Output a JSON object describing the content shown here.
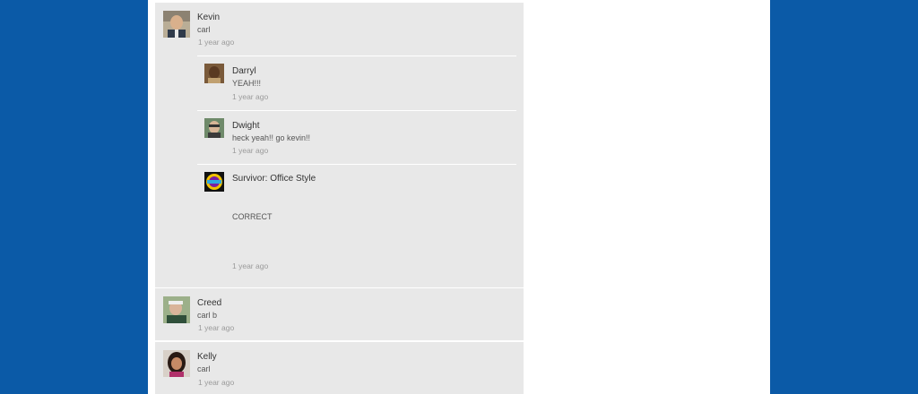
{
  "comments": [
    {
      "name": "Kevin",
      "text": "carl",
      "time": "1 year ago",
      "avatar_icon": "kevin-avatar-icon",
      "replies": [
        {
          "name": "Darryl",
          "text": "YEAH!!!",
          "time": "1 year ago",
          "avatar_icon": "darryl-avatar-icon"
        },
        {
          "name": "Dwight",
          "text": "heck yeah!! go kevin!!",
          "time": "1 year ago",
          "avatar_icon": "dwight-avatar-icon"
        },
        {
          "name": "Survivor: Office Style",
          "text": "CORRECT",
          "time": "1 year ago",
          "avatar_icon": "survivor-logo-icon"
        }
      ]
    },
    {
      "name": "Creed",
      "text": "carl b",
      "time": "1 year ago",
      "avatar_icon": "creed-avatar-icon"
    },
    {
      "name": "Kelly",
      "text": "carl",
      "time": "1 year ago",
      "avatar_icon": "kelly-avatar-icon"
    }
  ],
  "colors": {
    "background": "#0b5aa7",
    "card": "#e8e8e8"
  }
}
